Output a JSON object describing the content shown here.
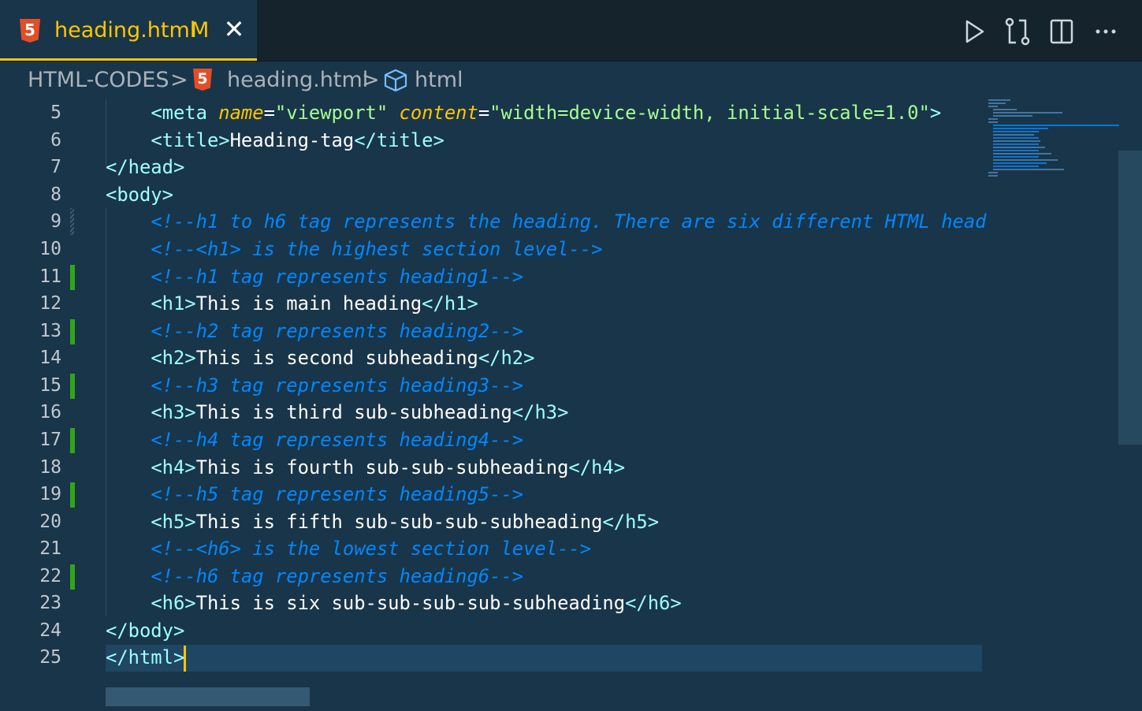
{
  "tab": {
    "file_name": "heading.html",
    "modified_badge": "M",
    "close_glyph": "✕",
    "icon_text": "5"
  },
  "toolbar": [
    {
      "name": "run-icon"
    },
    {
      "name": "compare-changes-icon"
    },
    {
      "name": "split-editor-icon"
    },
    {
      "name": "more-actions-icon"
    }
  ],
  "breadcrumb": {
    "folder": "HTML-CODES",
    "file": "heading.html",
    "symbol": "html",
    "separator": ">",
    "icon_text": "5"
  },
  "line_numbers": [
    "5",
    "6",
    "7",
    "8",
    "9",
    "10",
    "11",
    "12",
    "13",
    "14",
    "15",
    "16",
    "17",
    "18",
    "19",
    "20",
    "21",
    "22",
    "23",
    "24",
    "25"
  ],
  "code": {
    "l5": {
      "open": "<",
      "tag": "meta",
      "attr1": "name",
      "eq1": "=",
      "val1": "\"viewport\"",
      "attr2": "content",
      "eq2": "=",
      "val2": "\"width=device-width, initial-scale=1.0\"",
      "close": ">"
    },
    "l6": {
      "open": "<",
      "tag": "title",
      "gt": ">",
      "text": "Heading-tag",
      "end_open": "</",
      "end_tag": "title",
      "end_gt": ">"
    },
    "l7": {
      "open": "</",
      "tag": "head",
      "close": ">"
    },
    "l8": {
      "open": "<",
      "tag": "body",
      "close": ">"
    },
    "l9": "<!--h1 to h6 tag represents the heading. There are six different HTML head",
    "l10": "<!--<h1> is the highest section level-->",
    "l11": "<!--h1 tag represents heading1-->",
    "l12": {
      "open": "<",
      "tag": "h1",
      "gt": ">",
      "text": "This is main heading",
      "end_open": "</",
      "end_tag": "h1",
      "end_gt": ">"
    },
    "l13": "<!--h2 tag represents heading2-->",
    "l14": {
      "open": "<",
      "tag": "h2",
      "gt": ">",
      "text": "This is second subheading",
      "end_open": "</",
      "end_tag": "h2",
      "end_gt": ">"
    },
    "l15": "<!--h3 tag represents heading3-->",
    "l16": {
      "open": "<",
      "tag": "h3",
      "gt": ">",
      "text": "This is third sub-subheading",
      "end_open": "</",
      "end_tag": "h3",
      "end_gt": ">"
    },
    "l17": "<!--h4 tag represents heading4-->",
    "l18": {
      "open": "<",
      "tag": "h4",
      "gt": ">",
      "text": "This is fourth sub-sub-subheading",
      "end_open": "</",
      "end_tag": "h4",
      "end_gt": ">"
    },
    "l19": "<!--h5 tag represents heading5-->",
    "l20": {
      "open": "<",
      "tag": "h5",
      "gt": ">",
      "text": "This is fifth sub-sub-sub-subheading",
      "end_open": "</",
      "end_tag": "h5",
      "end_gt": ">"
    },
    "l21": "<!--<h6> is the lowest section level-->",
    "l22": "<!--h6 tag represents heading6-->",
    "l23": {
      "open": "<",
      "tag": "h6",
      "gt": ">",
      "text": "This is six sub-sub-sub-sub-subheading",
      "end_open": "</",
      "end_tag": "h6",
      "end_gt": ">"
    },
    "l24": {
      "open": "</",
      "tag": "body",
      "close": ">"
    },
    "l25": {
      "open": "</",
      "tag": "html",
      "close": ">"
    }
  },
  "colors": {
    "editor_bg": "#193549",
    "tag": "#9effff",
    "attribute": "#ffc600",
    "string": "#a5ff90",
    "comment": "#0088ff",
    "accent": "#ffc600",
    "git_added": "#3ad900"
  }
}
